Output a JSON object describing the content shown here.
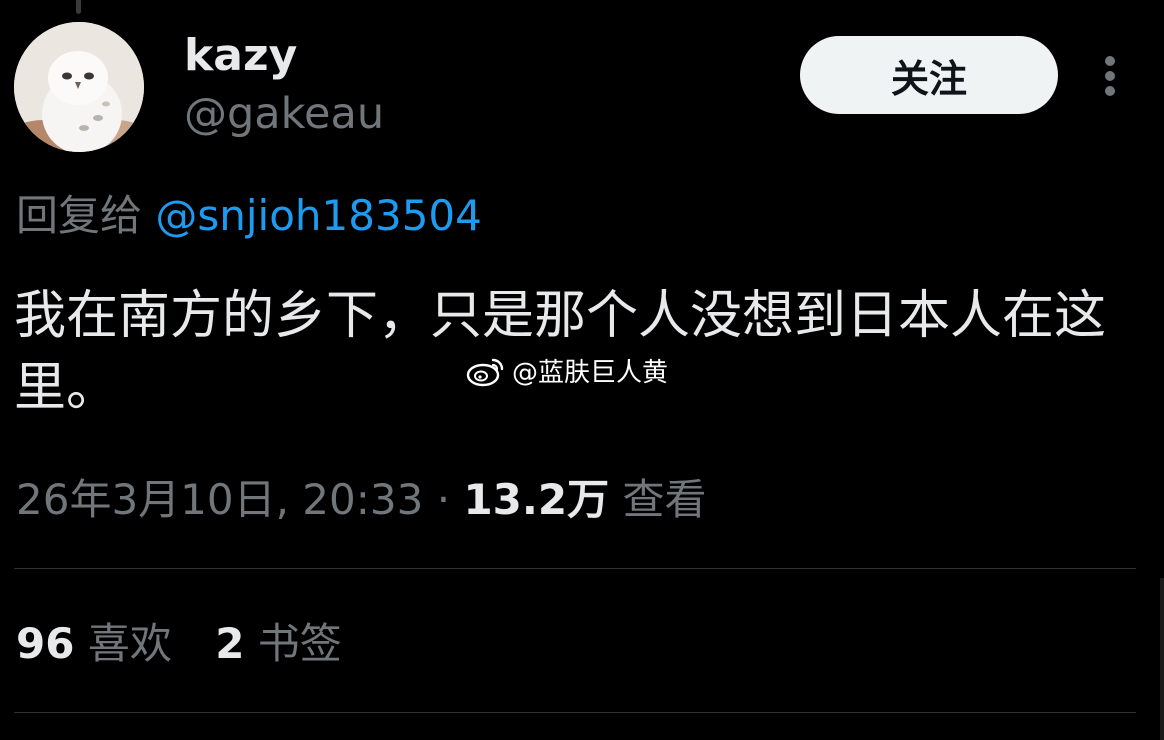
{
  "author": {
    "display_name": "kazy",
    "handle": "@gakeau",
    "avatar": "snowy-owl-avatar"
  },
  "actions": {
    "follow_label": "关注",
    "more_icon": "more-vertical-icon"
  },
  "reply": {
    "prefix": "回复给",
    "mention": "@snjioh183504"
  },
  "tweet": {
    "text": "我在南方的乡下，只是那个人没想到日本人在这里。"
  },
  "watermark": {
    "icon": "weibo-icon",
    "text": "@蓝肤巨人黄"
  },
  "meta": {
    "timestamp": "26年3月10日, 20:33",
    "separator": "·",
    "views_count": "13.2万",
    "views_label": "查看"
  },
  "stats": {
    "likes_count": "96",
    "likes_label": "喜欢",
    "bookmarks_count": "2",
    "bookmarks_label": "书签"
  },
  "colors": {
    "background": "#000000",
    "primary_text": "#e7e9ea",
    "secondary_text": "#71767b",
    "link": "#1d9bf0",
    "divider": "#2f3336",
    "follow_button_bg": "#eff3f4"
  }
}
